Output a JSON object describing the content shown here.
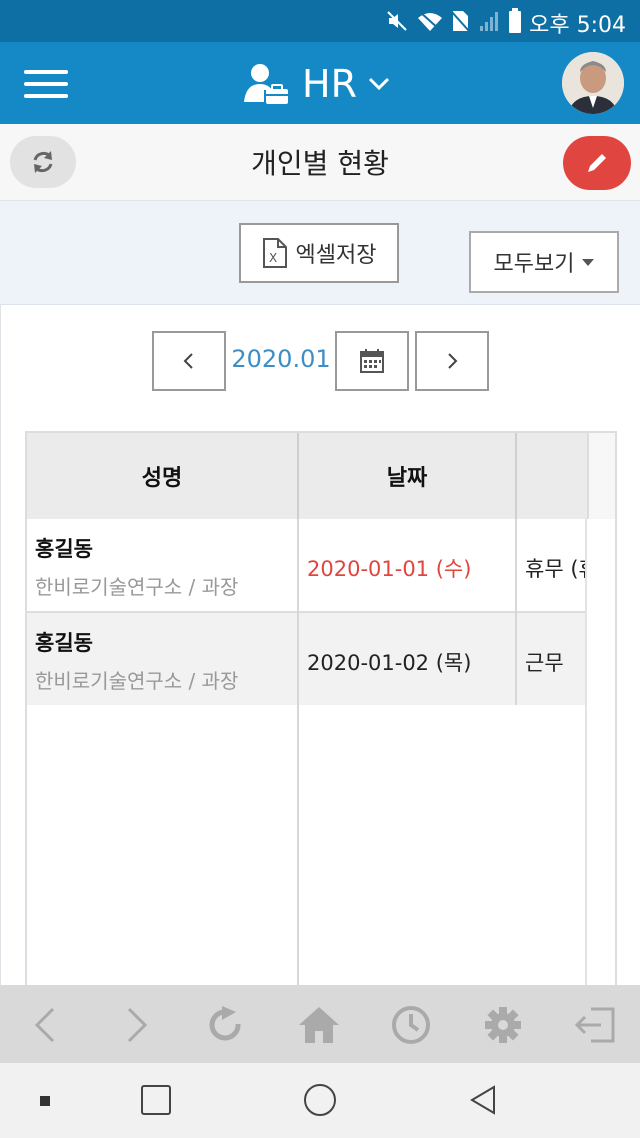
{
  "status_bar": {
    "time": "오후 5:04",
    "icons": [
      "mute-icon",
      "wifi-icon",
      "no-sim-icon",
      "signal-icon",
      "battery-icon"
    ]
  },
  "app_bar": {
    "app_name": "HR",
    "menu_icon": "hamburger-icon",
    "logo_icon": "user-briefcase-icon",
    "dropdown_icon": "chevron-down-icon"
  },
  "title_bar": {
    "title": "개인별 현황"
  },
  "toolbar": {
    "excel_label": "엑셀저장",
    "filter_label": "모두보기"
  },
  "period": {
    "month": "2020.01"
  },
  "table": {
    "headers": [
      "성명",
      "날짜",
      ""
    ],
    "rows": [
      {
        "name": "홍길동",
        "dept": "한비로기술연구소 / 과장",
        "date": "2020-01-01 (수)",
        "status": "휴무 (휴",
        "highlight": true
      },
      {
        "name": "홍길동",
        "dept": "한비로기술연구소 / 과장",
        "date": "2020-01-02 (목)",
        "status": "근무",
        "highlight": false
      }
    ]
  },
  "colors": {
    "header_blue": "#1489c6",
    "status_blue": "#0d6fa3",
    "accent_red": "#e0463f",
    "link_blue": "#3e8ec6",
    "holiday_red": "#e0463f"
  }
}
